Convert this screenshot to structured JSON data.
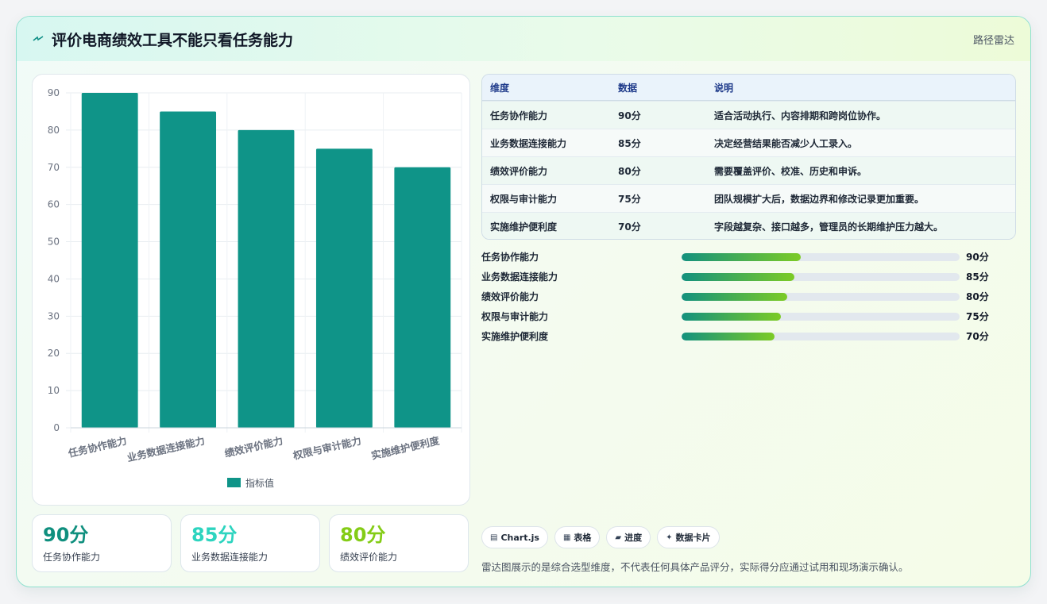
{
  "header": {
    "title": "评价电商绩效工具不能只看任务能力",
    "tag": "路径雷达",
    "icon": "lightning-icon"
  },
  "chart_data": {
    "type": "bar",
    "categories": [
      "任务协作能力",
      "业务数据连接能力",
      "绩效评价能力",
      "权限与审计能力",
      "实施维护便利度"
    ],
    "series": [
      {
        "name": "指标值",
        "values": [
          90,
          85,
          80,
          75,
          70
        ],
        "color": "#0f9488"
      }
    ],
    "ylim": [
      0,
      90
    ],
    "yticks": [
      0,
      10,
      20,
      30,
      40,
      50,
      60,
      70,
      80,
      90
    ],
    "grid": true,
    "legend": "bottom"
  },
  "table": {
    "headers": [
      "维度",
      "数据",
      "说明"
    ],
    "rows": [
      [
        "任务协作能力",
        "90分",
        "适合活动执行、内容排期和跨岗位协作。"
      ],
      [
        "业务数据连接能力",
        "85分",
        "决定经营结果能否减少人工录入。"
      ],
      [
        "绩效评价能力",
        "80分",
        "需要覆盖评价、校准、历史和申诉。"
      ],
      [
        "权限与审计能力",
        "75分",
        "团队规模扩大后，数据边界和修改记录更加重要。"
      ],
      [
        "实施维护便利度",
        "70分",
        "字段越复杂、接口越多，管理员的长期维护压力越大。"
      ]
    ]
  },
  "progress": [
    {
      "label": "任务协作能力",
      "value": 90,
      "text": "90分"
    },
    {
      "label": "业务数据连接能力",
      "value": 85,
      "text": "85分"
    },
    {
      "label": "绩效评价能力",
      "value": 80,
      "text": "80分"
    },
    {
      "label": "权限与审计能力",
      "value": 75,
      "text": "75分"
    },
    {
      "label": "实施维护便利度",
      "value": 70,
      "text": "70分"
    }
  ],
  "progress_max": 210,
  "stats": [
    {
      "value": "90分",
      "label": "任务协作能力",
      "color": "#0f8f7e"
    },
    {
      "value": "85分",
      "label": "业务数据连接能力",
      "color": "#2dd4bf"
    },
    {
      "value": "80分",
      "label": "绩效评价能力",
      "color": "#84cc16"
    }
  ],
  "chips": [
    {
      "icon": "chart-icon",
      "glyph": "▤",
      "label": "Chart.js"
    },
    {
      "icon": "table-icon",
      "glyph": "▦",
      "label": "表格"
    },
    {
      "icon": "progress-icon",
      "glyph": "▰",
      "label": "进度"
    },
    {
      "icon": "card-icon",
      "glyph": "✦",
      "label": "数据卡片"
    }
  ],
  "note": "雷达图展示的是综合选型维度，不代表任何具体产品评分，实际得分应通过试用和现场演示确认。"
}
